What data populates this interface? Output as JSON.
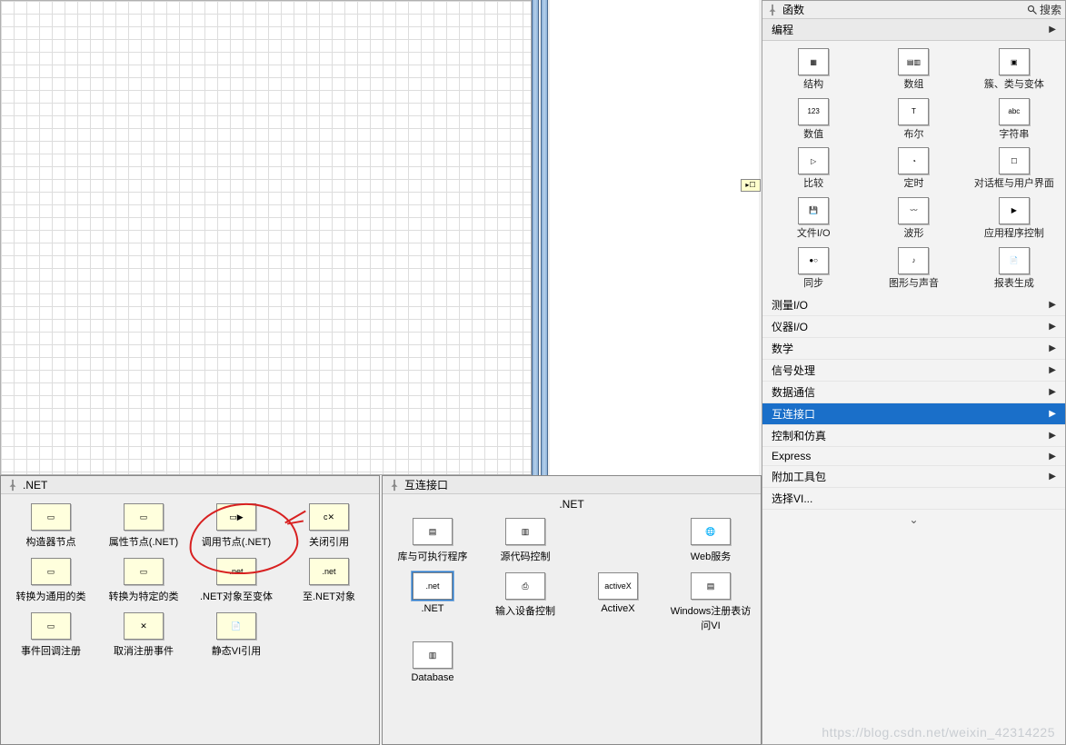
{
  "functions_palette": {
    "title": "函数",
    "search_label": "搜索",
    "category_header": "编程",
    "items": [
      {
        "label": "结构"
      },
      {
        "label": "数组"
      },
      {
        "label": "簇、类与变体"
      },
      {
        "label": "数值"
      },
      {
        "label": "布尔"
      },
      {
        "label": "字符串"
      },
      {
        "label": "比较"
      },
      {
        "label": "定时"
      },
      {
        "label": "对话框与用户界面"
      },
      {
        "label": "文件I/O"
      },
      {
        "label": "波形"
      },
      {
        "label": "应用程序控制"
      },
      {
        "label": "同步"
      },
      {
        "label": "图形与声音"
      },
      {
        "label": "报表生成"
      }
    ],
    "menu": [
      {
        "label": "测量I/O"
      },
      {
        "label": "仪器I/O"
      },
      {
        "label": "数学"
      },
      {
        "label": "信号处理"
      },
      {
        "label": "数据通信"
      },
      {
        "label": "互连接口",
        "selected": true
      },
      {
        "label": "控制和仿真"
      },
      {
        "label": "Express"
      },
      {
        "label": "附加工具包"
      },
      {
        "label": "选择VI..."
      }
    ]
  },
  "net_palette": {
    "title": ".NET",
    "items": [
      {
        "label": "构造器节点"
      },
      {
        "label": "属性节点(.NET)"
      },
      {
        "label": "调用节点(.NET)",
        "circled": true
      },
      {
        "label": "关闭引用"
      },
      {
        "label": "转换为通用的类"
      },
      {
        "label": "转换为特定的类"
      },
      {
        "label": ".NET对象至变体"
      },
      {
        "label": "至.NET对象"
      },
      {
        "label": "事件回调注册"
      },
      {
        "label": "取消注册事件"
      },
      {
        "label": "静态VI引用"
      }
    ]
  },
  "interop_palette": {
    "title": "互连接口",
    "header_label": ".NET",
    "items": [
      {
        "label": "库与可执行程序"
      },
      {
        "label": "源代码控制"
      },
      {
        "label": ""
      },
      {
        "label": "Web服务"
      },
      {
        "label": ".NET",
        "selected": true
      },
      {
        "label": "输入设备控制"
      },
      {
        "label": "ActiveX"
      },
      {
        "label": "Windows注册表访问VI"
      },
      {
        "label": "Database"
      }
    ]
  },
  "watermark": "https://blog.csdn.net/weixin_42314225"
}
